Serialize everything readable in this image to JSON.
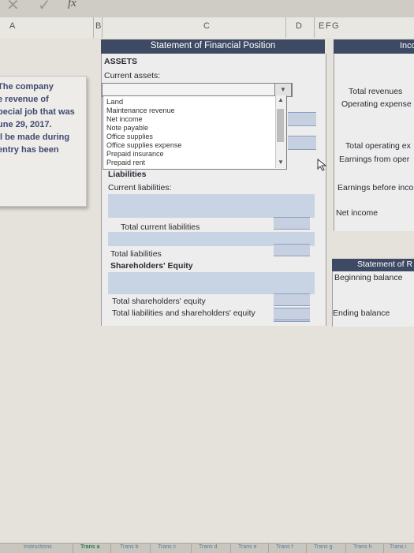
{
  "formula_bar": {
    "fx_label": "fx"
  },
  "columns": [
    "A",
    "B",
    "C",
    "D",
    "E",
    "F",
    "G"
  ],
  "instructions": {
    "lines": [
      "The company",
      "e revenue of",
      "pecial job that was",
      "une 29, 2017.",
      "ll be made during",
      "entry has been"
    ]
  },
  "sfp": {
    "title": "Statement of Financial Position",
    "assets": "ASSETS",
    "current_assets": "Current assets:",
    "liabilities": "Liabilities",
    "current_liabilities": "Current liabilities:",
    "total_current_liabilities": "Total current liabilities",
    "total_liabilities": "Total liabilities",
    "shareholders_equity": "Shareholders' Equity",
    "total_shareholders_equity": "Total shareholders' equity",
    "total_liab_and_equity": "Total liabilities and shareholders' equity"
  },
  "dropdown": {
    "value": "",
    "options": [
      "Land",
      "Maintenance revenue",
      "Net income",
      "Note payable",
      "Office supplies",
      "Office supplies expense",
      "Prepaid insurance",
      "Prepaid rent"
    ]
  },
  "income_statement": {
    "title": "Inco",
    "total_revenues": "Total revenues",
    "operating_expenses": "Operating expense",
    "total_operating": "Total operating ex",
    "earnings_from_ops": "Earnings from oper",
    "earnings_before": "Earnings before inco",
    "net_income": "Net income"
  },
  "retained_earnings": {
    "title": "Statement of R",
    "beginning_balance": "Beginning balance",
    "ending_balance": "Ending balance"
  },
  "tabs": [
    "Instructions",
    "Trans a",
    "Trans b",
    "Trans c",
    "Trans d",
    "Trans e",
    "Trans f",
    "Trans g",
    "Trans h",
    "Trans i"
  ],
  "active_tab": "Trans a",
  "colors": {
    "header_bg": "#3e4a63",
    "input_cell": "#c8d3e3",
    "active_tab": "#2f7d55"
  }
}
